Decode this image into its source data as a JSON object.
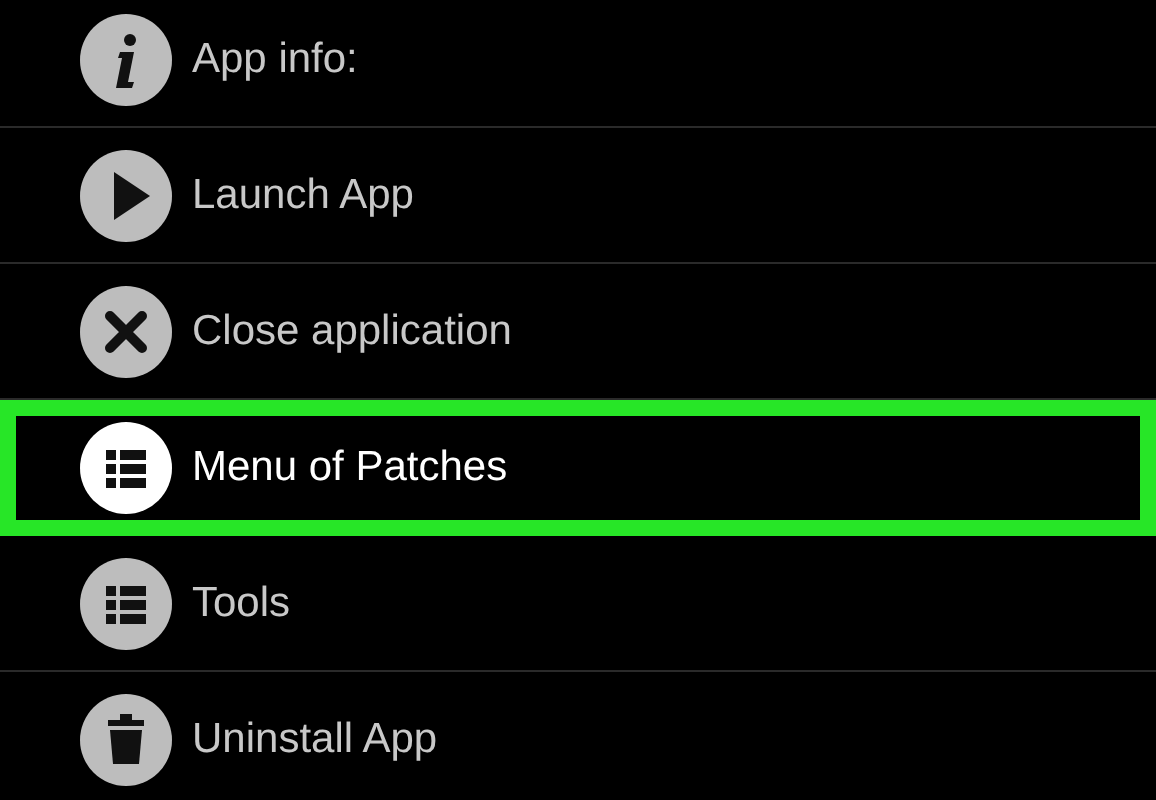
{
  "menu": {
    "items": [
      {
        "label": "App info:",
        "kind": "info",
        "selected": false
      },
      {
        "label": "Launch App",
        "kind": "play",
        "selected": false
      },
      {
        "label": "Close application",
        "kind": "close",
        "selected": false
      },
      {
        "label": "Menu of Patches",
        "kind": "list",
        "selected": true
      },
      {
        "label": "Tools",
        "kind": "list",
        "selected": false
      },
      {
        "label": "Uninstall App",
        "kind": "trash",
        "selected": false
      }
    ]
  }
}
